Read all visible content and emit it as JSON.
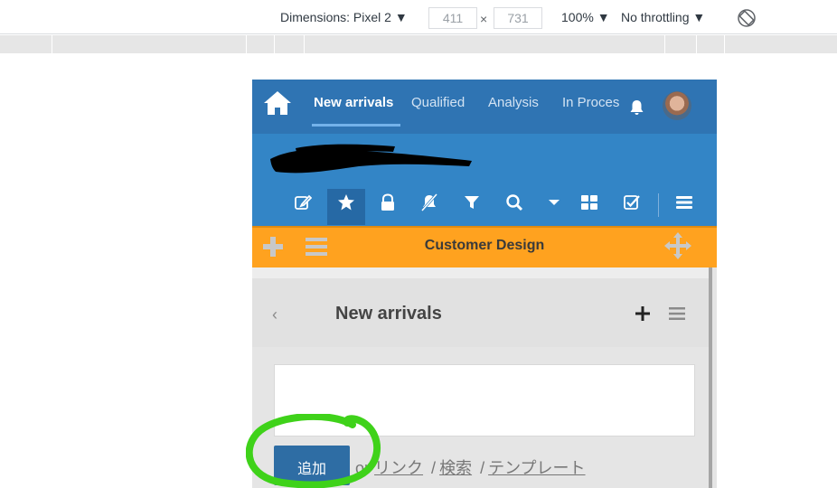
{
  "devtools": {
    "dimensions_label": "Dimensions: Pixel 2 ▼",
    "width": "411",
    "height": "731",
    "times": "×",
    "zoom": "100% ▼",
    "throttling": "No throttling ▼",
    "rotate_icon": "rotate-icon"
  },
  "app": {
    "nav": {
      "home_icon": "home-icon",
      "tabs": [
        {
          "label": "New arrivals",
          "active": true
        },
        {
          "label": "Qualified"
        },
        {
          "label": "Analysis"
        },
        {
          "label": "In Proces"
        }
      ],
      "bell_icon": "bell-icon",
      "avatar": "user-avatar"
    },
    "toolbar": {
      "icons": [
        "edit-icon",
        "star-icon",
        "lock-icon",
        "notification-off-icon",
        "filter-icon",
        "search-icon",
        "caret-down-icon",
        "grid-icon",
        "checkbox-icon",
        "menu-icon"
      ]
    },
    "panel": {
      "title": "Customer Design",
      "icons": [
        "plus-icon",
        "lines-icon",
        "move-icon"
      ]
    },
    "list": {
      "back": "‹",
      "title": "New arrivals",
      "icons": [
        "add-icon",
        "list-menu-icon"
      ]
    },
    "composer": {
      "placeholder": "",
      "add_button": "追加",
      "or": "or",
      "link": "リンク",
      "search": "検索",
      "template": "テンプレート",
      "sep": "/"
    },
    "colors": {
      "nav": "#2f74b3",
      "title": "#3385c6",
      "panel": "#ffa21f",
      "button": "#2e6da4",
      "annotation": "#3fd21a"
    }
  }
}
